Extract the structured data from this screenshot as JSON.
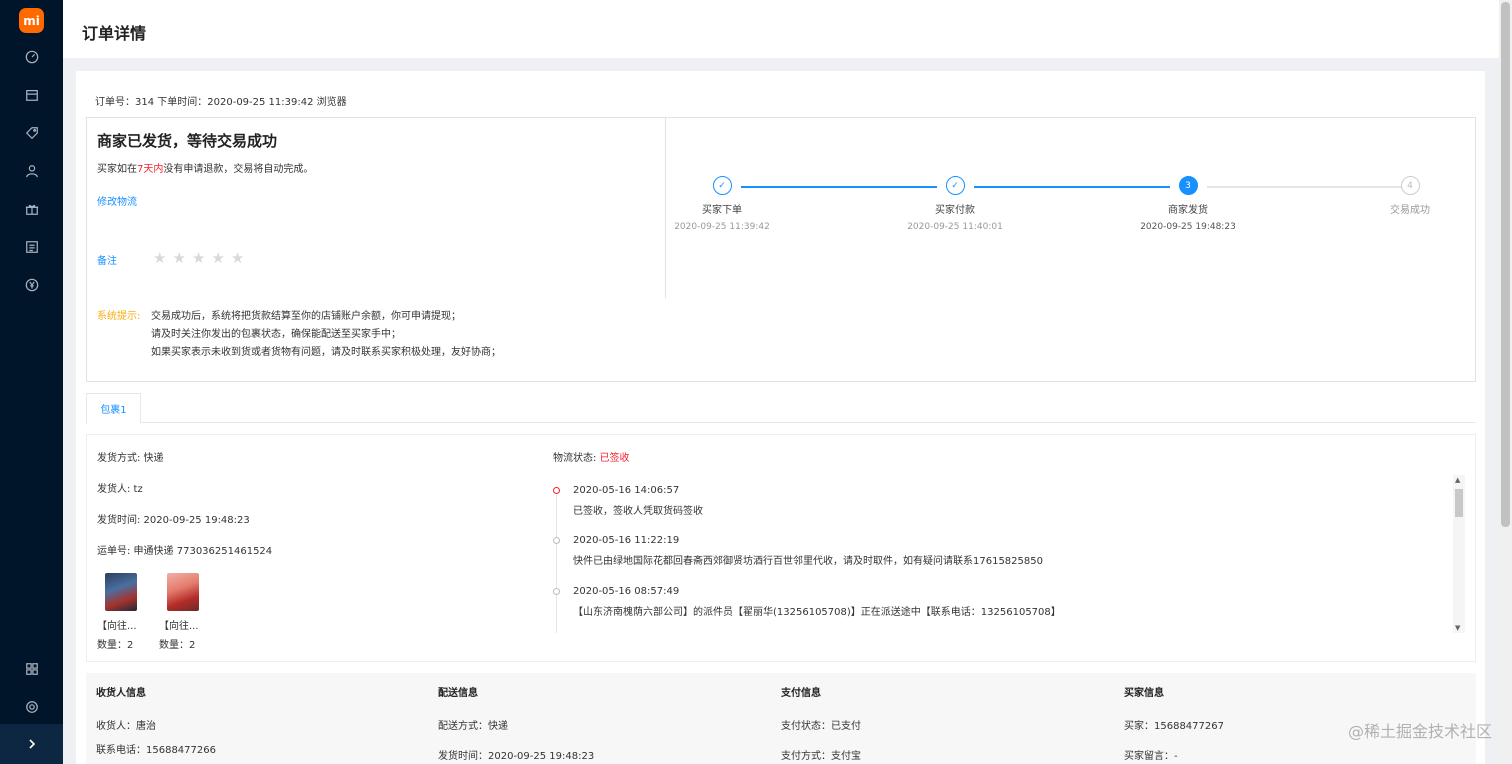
{
  "app": {
    "logo_text": "mi"
  },
  "sidebar": {
    "icons": [
      "dashboard-icon",
      "store-icon",
      "tag-icon",
      "user-icon",
      "gift-icon",
      "list-icon",
      "yuan-icon"
    ],
    "bottom_icons": [
      "apps-icon",
      "settings-icon"
    ],
    "collapse_icon": "chevron-right-icon"
  },
  "header": {
    "title": "订单详情"
  },
  "order": {
    "summary": "订单号：314 下单时间：2020-09-25 11:39:42 浏览器"
  },
  "status": {
    "title": "商家已发货，等待交易成功",
    "sub_prefix": "买家如在",
    "sub_highlight": "7天内",
    "sub_suffix": "没有申请退款，交易将自动完成。",
    "modify_logistics": "修改物流",
    "remark": "备注",
    "rating": 0,
    "rating_max": 5
  },
  "steps": [
    {
      "label": "买家下单",
      "time": "2020-09-25 11:39:42",
      "state": "done",
      "num": "1"
    },
    {
      "label": "买家付款",
      "time": "2020-09-25 11:40:01",
      "state": "done",
      "num": "2"
    },
    {
      "label": "商家发货",
      "time": "2020-09-25 19:48:23",
      "state": "active",
      "num": "3"
    },
    {
      "label": "交易成功",
      "time": "",
      "state": "wait",
      "num": "4"
    }
  ],
  "tips": {
    "label": "系统提示:",
    "lines": [
      "交易成功后，系统将把货款结算至你的店铺账户余额，你可申请提现；",
      "请及时关注你发出的包裹状态，确保能配送至买家手中；",
      "如果买家表示未收到货或者货物有问题，请及时联系买家积极处理，友好协商；"
    ]
  },
  "tabs": [
    {
      "label": "包裹1",
      "active": true
    }
  ],
  "package": {
    "ship_method": "发货方式: 快递",
    "shipper": "发货人: tz",
    "ship_time": "发货时间: 2020-09-25 19:48:23",
    "waybill": "运单号: 申通快递 773036251461524",
    "goods": [
      {
        "name": "【向往...",
        "qty": "数量：2"
      },
      {
        "name": "【向往...",
        "qty": "数量：2"
      }
    ],
    "logistics_label": "物流状态:",
    "logistics_status": "已签收",
    "timeline": [
      {
        "time": "2020-05-16 14:06:57",
        "text": "已签收，签收人凭取货码签收"
      },
      {
        "time": "2020-05-16 11:22:19",
        "text": "快件已由绿地国际花都回春斋西郊御贤坊酒行百世邻里代收，请及时取件，如有疑问请联系17615825850"
      },
      {
        "time": "2020-05-16 08:57:49",
        "text": "【山东济南槐荫六部公司】的派件员【翟丽华(13256105708)】正在派送途中【联系电话：13256105708】"
      }
    ]
  },
  "info": {
    "receiver": {
      "head": "收货人信息",
      "rows": [
        "收货人：唐治",
        "联系电话：15688477266"
      ]
    },
    "delivery": {
      "head": "配送信息",
      "rows": [
        "配送方式：快递",
        "发货时间：2020-09-25 19:48:23"
      ]
    },
    "payment": {
      "head": "支付信息",
      "rows": [
        "支付状态：已支付",
        "支付方式：支付宝"
      ]
    },
    "buyer": {
      "head": "买家信息",
      "rows": [
        "买家：15688477267",
        "买家留言：-"
      ]
    }
  },
  "watermark": "@稀土掘金技术社区",
  "colors": {
    "accent": "#1890ff",
    "danger": "#f5222d",
    "warning": "#faad14",
    "sidebar": "#001529"
  }
}
